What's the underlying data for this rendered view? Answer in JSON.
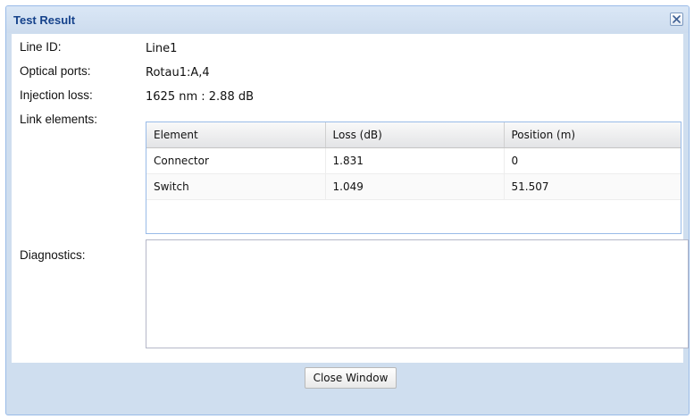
{
  "window": {
    "title": "Test Result",
    "close_icon": "close-icon"
  },
  "fields": {
    "line_id": {
      "label": "Line ID:",
      "value": "Line1"
    },
    "optical_ports": {
      "label": "Optical ports:",
      "value": "Rotau1:A,4"
    },
    "injection_loss": {
      "label": "Injection loss:",
      "value": "1625 nm : 2.88 dB"
    },
    "link_elements": {
      "label": "Link elements:"
    },
    "diagnostics": {
      "label": "Diagnostics:",
      "value": ""
    }
  },
  "link_table": {
    "headers": [
      "Element",
      "Loss (dB)",
      "Position (m)"
    ],
    "rows": [
      [
        "Connector",
        "1.831",
        "0"
      ],
      [
        "Switch",
        "1.049",
        "51.507"
      ]
    ]
  },
  "footer": {
    "close_button": "Close Window"
  },
  "colors": {
    "title_text": "#15428b",
    "window_frame": "#99bbe8",
    "window_body": "#cfdeef"
  }
}
